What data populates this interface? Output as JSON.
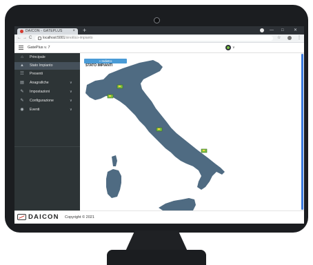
{
  "browser": {
    "tab_title": "DAICON - GATEPLUS",
    "tab_close": "×",
    "new_tab": "+",
    "url_host": "localhost:5001",
    "url_path": "/sinottico-impianto",
    "window_controls": [
      "—",
      "□",
      "✕"
    ],
    "nav": {
      "back": "←",
      "forward": "→",
      "reload": "C"
    },
    "star": "☆",
    "menu": "⋮"
  },
  "app": {
    "title": "GatePlus v. 7",
    "user_caret": "∨"
  },
  "sidebar": {
    "items": [
      {
        "label": "Principale",
        "icon": "home-icon",
        "glyph": "⌂",
        "active": false,
        "caret": ""
      },
      {
        "label": "Stato Impianto",
        "icon": "warning-icon",
        "glyph": "▲",
        "active": true,
        "caret": ""
      },
      {
        "label": "Presenti",
        "icon": "users-icon",
        "glyph": "☷",
        "active": false,
        "caret": ""
      },
      {
        "label": "Anagrafiche",
        "icon": "list-icon",
        "glyph": "▤",
        "active": false,
        "caret": "∨"
      },
      {
        "label": "Impostazioni",
        "icon": "wrench-icon",
        "glyph": "✎",
        "active": false,
        "caret": "∨"
      },
      {
        "label": "Configurazione",
        "icon": "wrench-icon",
        "glyph": "✎",
        "active": false,
        "caret": "∨"
      },
      {
        "label": "Eventi",
        "icon": "eye-icon",
        "glyph": "◉",
        "active": false,
        "caret": "∨"
      }
    ]
  },
  "main": {
    "back_button": "« Indietro",
    "title": "STATO IMPIANTI"
  },
  "map": {
    "region_color": "#4f6b82",
    "marker_color": "#7bc143",
    "markers": [
      {
        "name": "marker-milano"
      },
      {
        "name": "marker-torino"
      },
      {
        "name": "marker-roma"
      },
      {
        "name": "marker-bari"
      }
    ]
  },
  "footer": {
    "logo": "DAICON",
    "copyright": "Copyright © 2021"
  }
}
